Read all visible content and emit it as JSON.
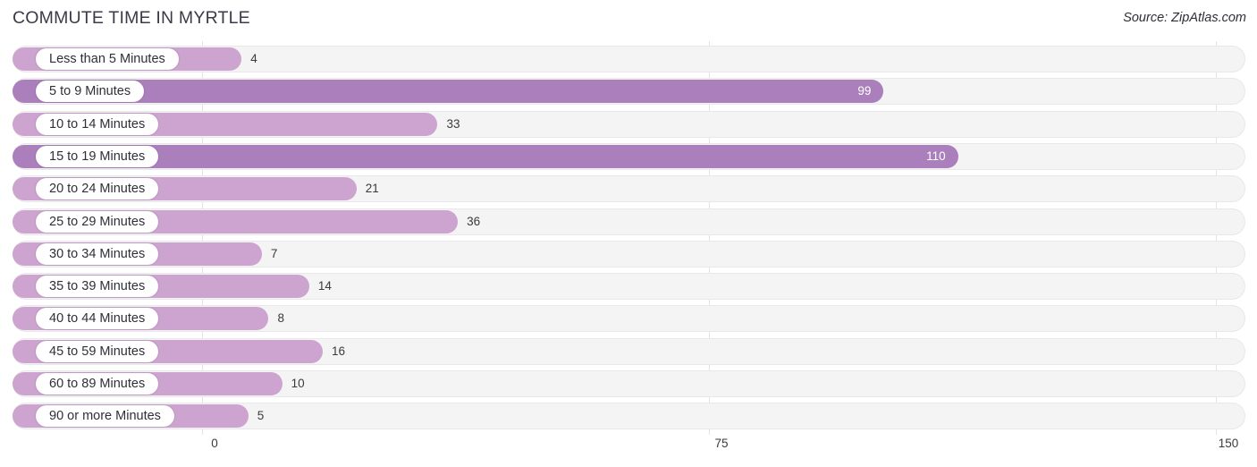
{
  "header": {
    "title": "COMMUTE TIME IN MYRTLE",
    "source": "Source: ZipAtlas.com"
  },
  "colors": {
    "bar_light": "#cda3d0",
    "bar_dark": "#ab7fbc",
    "track": "#f4f4f4",
    "track_border": "#e8e8e8",
    "gridline": "#e3e3e3",
    "title": "#3b3b48",
    "text": "#3a3a3a"
  },
  "chart_data": {
    "type": "bar",
    "orientation": "horizontal",
    "title": "COMMUTE TIME IN MYRTLE",
    "xlabel": "",
    "ylabel": "",
    "xlim": [
      0,
      150
    ],
    "ticks": [
      0,
      75,
      150
    ],
    "tick_labels": [
      "0",
      "75",
      "150"
    ],
    "grid": true,
    "legend": null,
    "categories": [
      "Less than 5 Minutes",
      "5 to 9 Minutes",
      "10 to 14 Minutes",
      "15 to 19 Minutes",
      "20 to 24 Minutes",
      "25 to 29 Minutes",
      "30 to 34 Minutes",
      "35 to 39 Minutes",
      "40 to 44 Minutes",
      "45 to 59 Minutes",
      "60 to 89 Minutes",
      "90 or more Minutes"
    ],
    "values": [
      4,
      99,
      33,
      110,
      21,
      36,
      7,
      14,
      8,
      16,
      10,
      5
    ],
    "value_labels": [
      "4",
      "99",
      "33",
      "110",
      "21",
      "36",
      "7",
      "14",
      "8",
      "16",
      "10",
      "5"
    ]
  }
}
